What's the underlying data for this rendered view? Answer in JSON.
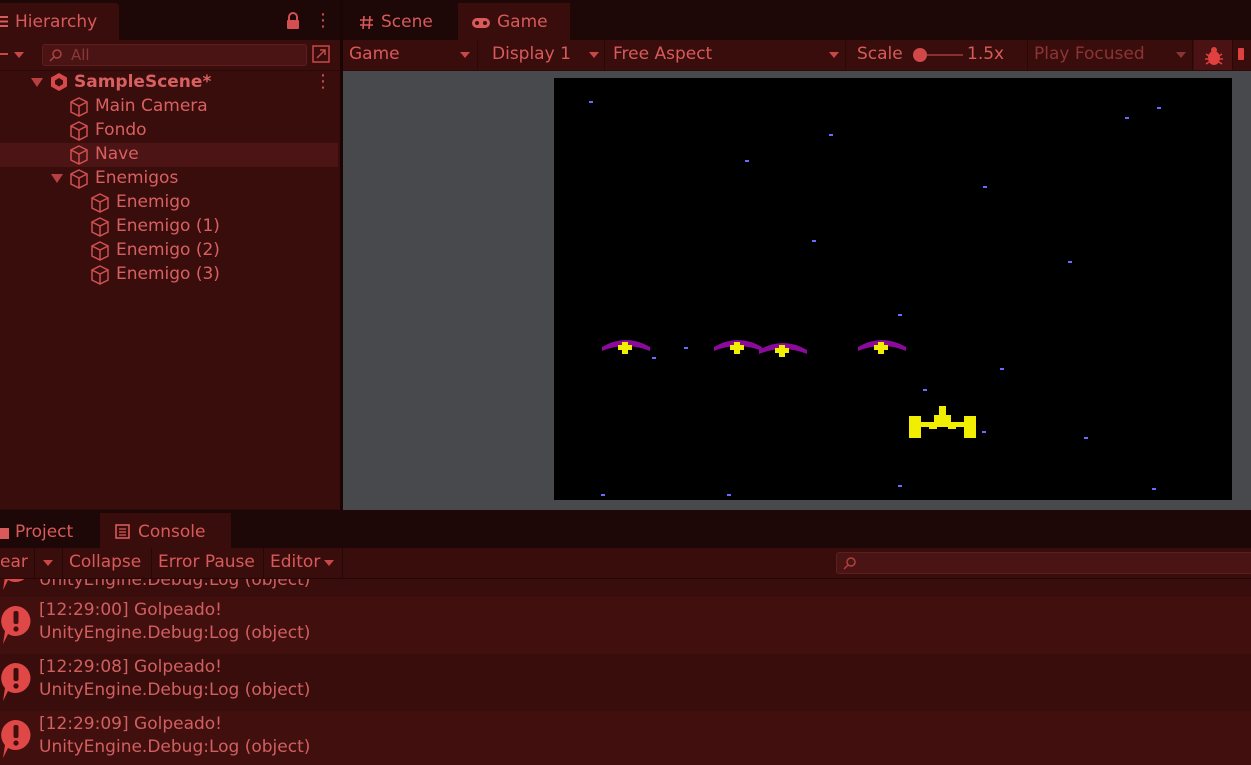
{
  "hierarchy": {
    "tab_label": "Hierarchy",
    "search_placeholder": "All",
    "scene_name": "SampleScene*",
    "items": [
      {
        "label": "Main Camera"
      },
      {
        "label": "Fondo"
      },
      {
        "label": "Nave"
      },
      {
        "label": "Enemigos"
      },
      {
        "label": "Enemigo"
      },
      {
        "label": "Enemigo (1)"
      },
      {
        "label": "Enemigo (2)"
      },
      {
        "label": "Enemigo (3)"
      }
    ],
    "selected_item": "Nave"
  },
  "view_tabs": [
    {
      "label": "Scene",
      "icon": "hash-icon"
    },
    {
      "label": "Game",
      "icon": "gamepad-icon"
    }
  ],
  "game_toolbar": {
    "view_select": "Game",
    "display_select": "Display 1",
    "aspect_select": "Free Aspect",
    "scale_label": "Scale",
    "scale_value": "1.5x",
    "play_mode_select": "Play Focused"
  },
  "bottom_tabs": [
    {
      "label": "Project",
      "icon": "folder-icon"
    },
    {
      "label": "Console",
      "icon": "console-icon"
    }
  ],
  "console_toolbar": {
    "clear_label": "ear",
    "collapse_label": "Collapse",
    "error_pause_label": "Error Pause",
    "editor_label": "Editor"
  },
  "console": {
    "partial_line": "UnityEngine.Debug:Log (object)",
    "entries": [
      {
        "message": "[12:29:00] Golpeado!",
        "trace": "UnityEngine.Debug:Log (object)"
      },
      {
        "message": "[12:29:08] Golpeado!",
        "trace": "UnityEngine.Debug:Log (object)"
      },
      {
        "message": "[12:29:09] Golpeado!",
        "trace": "UnityEngine.Debug:Log (object)"
      }
    ]
  },
  "colors": {
    "theme_tint": "#3a0d0d",
    "text": "#d85a5a",
    "game_background": "#000000",
    "enemy": "#8a0a9a",
    "ship": "#f2ee00",
    "stars": "#6a6aff"
  }
}
